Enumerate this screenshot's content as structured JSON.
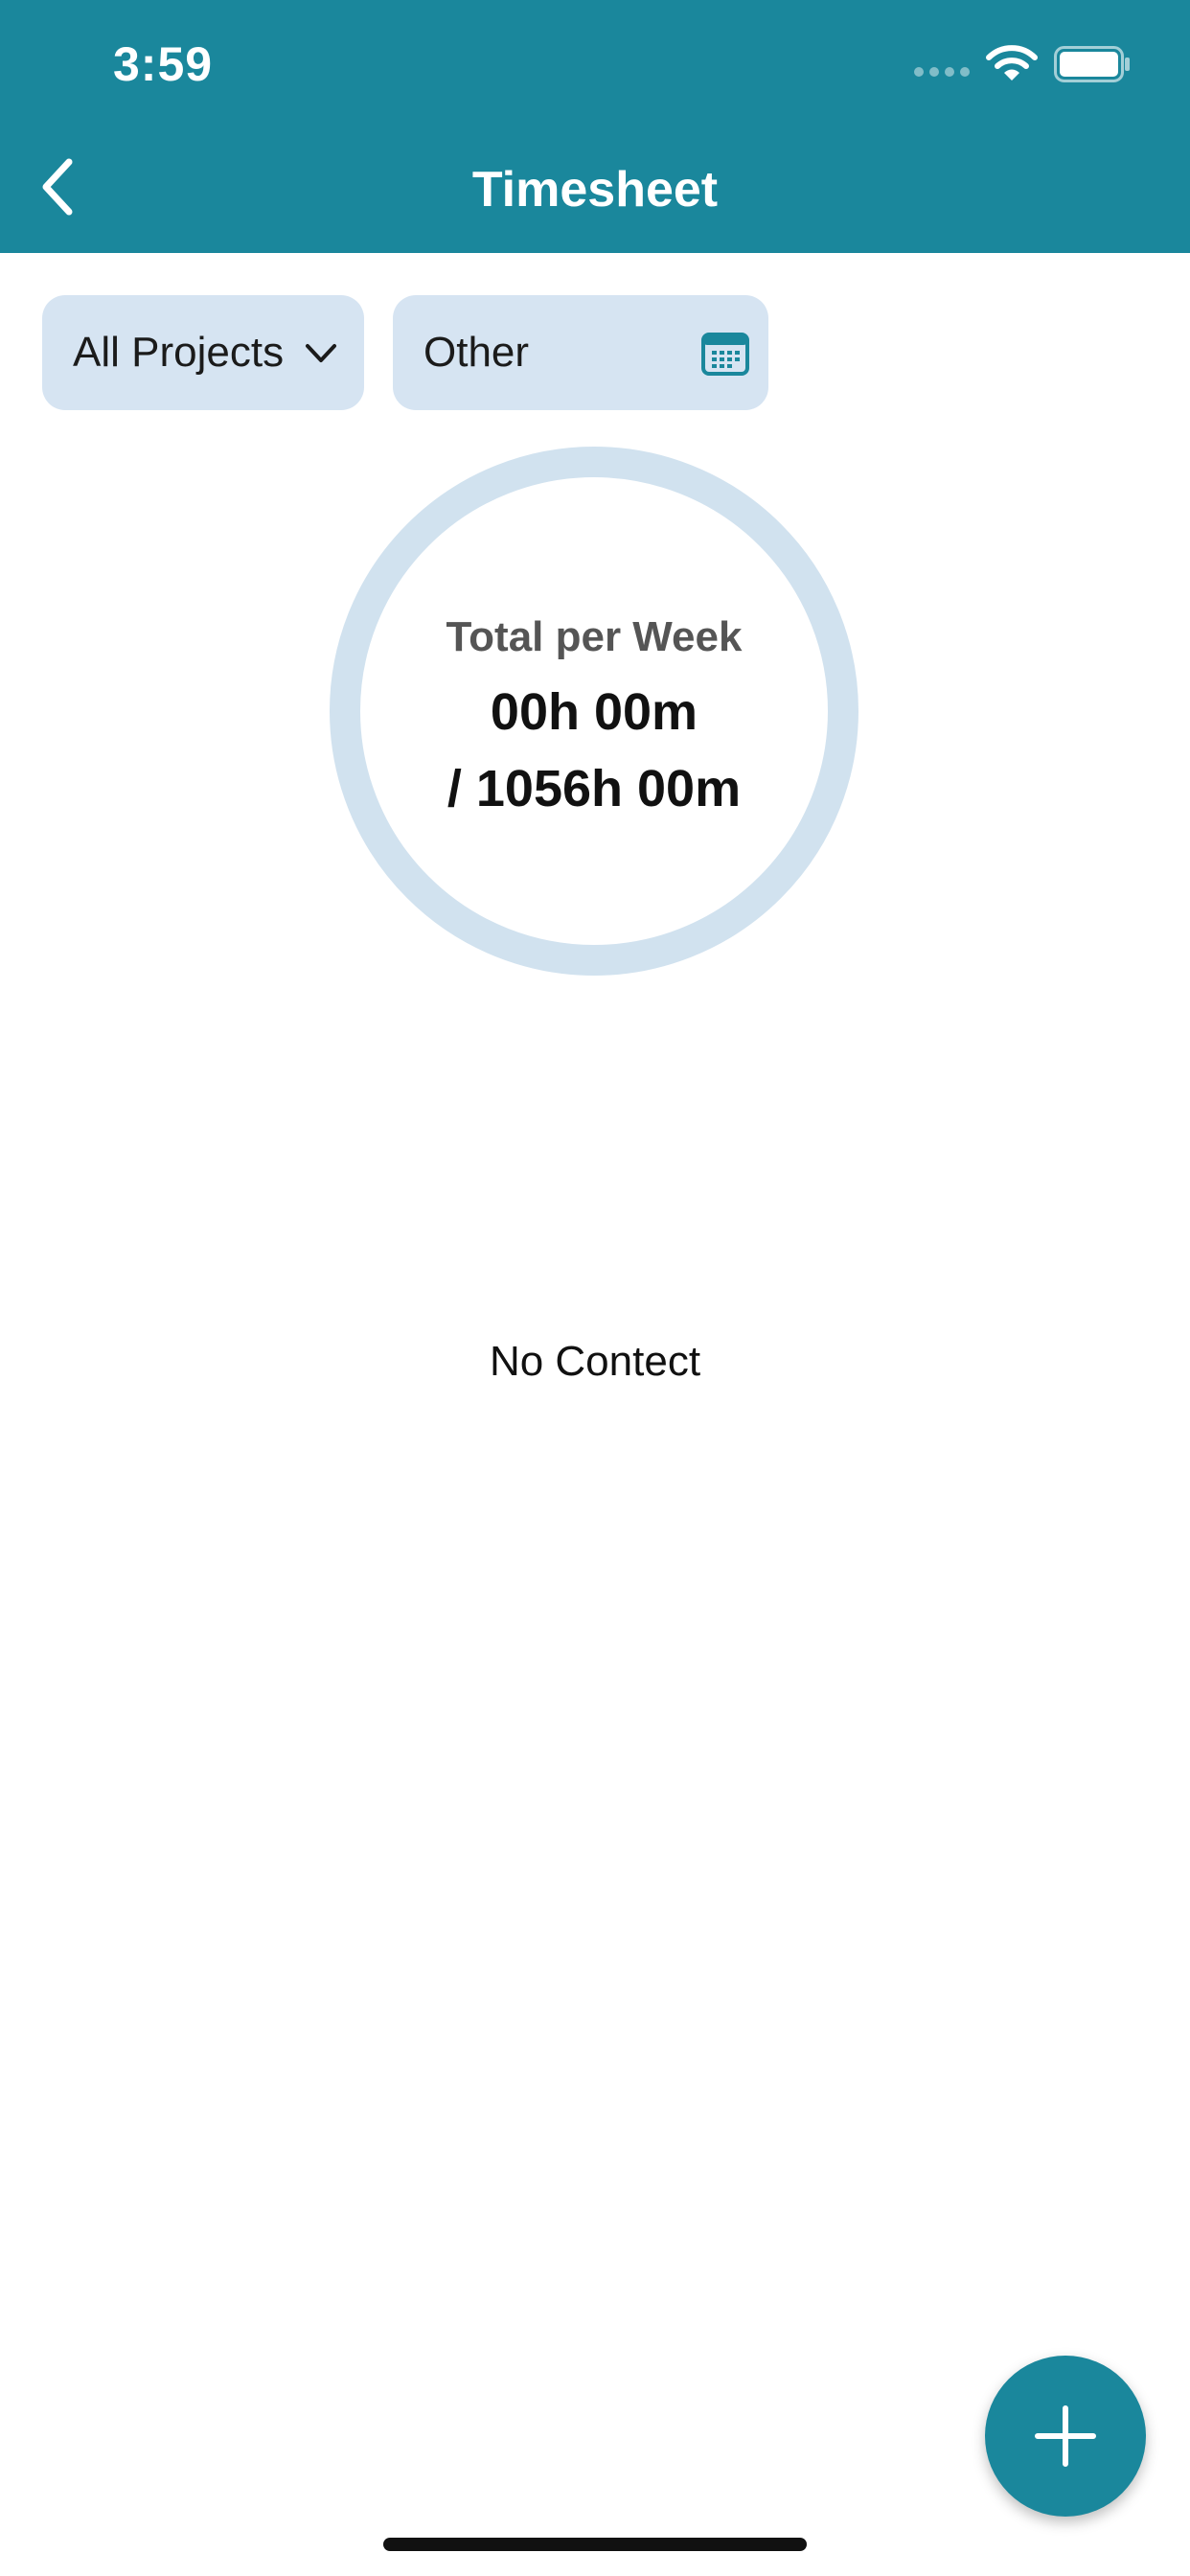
{
  "status_bar": {
    "time": "3:59"
  },
  "nav": {
    "title": "Timesheet",
    "back_icon": "chevron-left-icon"
  },
  "filters": {
    "project": {
      "value": "All Projects",
      "icon": "chevron-down-icon"
    },
    "period": {
      "value": "Other",
      "icon": "calendar-icon"
    }
  },
  "summary": {
    "label": "Total per Week",
    "logged": "00h 00m",
    "total": "/ 1056h 00m",
    "progress": 0
  },
  "empty_state": {
    "text": "No Contect"
  },
  "fab": {
    "icon": "plus-icon"
  },
  "colors": {
    "primary": "#1a879c",
    "filter_bg": "#d6e4f2",
    "ring": "#d1e2ef"
  }
}
